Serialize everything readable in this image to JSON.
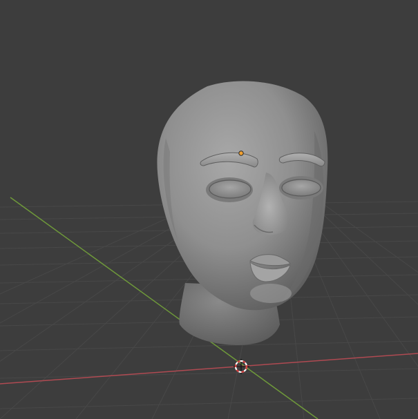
{
  "viewport": {
    "view": "3D Viewport",
    "background_color": "#3d3d3d",
    "grid_color": "#4a4a4a",
    "x_axis_color": "#b04a52",
    "y_axis_color": "#6f9a3a"
  },
  "scene": {
    "object": "head-mesh",
    "object_color": "#8e8e8e",
    "selected_origin_color": "#f0a030",
    "cursor_icon": "3d-cursor-icon"
  }
}
